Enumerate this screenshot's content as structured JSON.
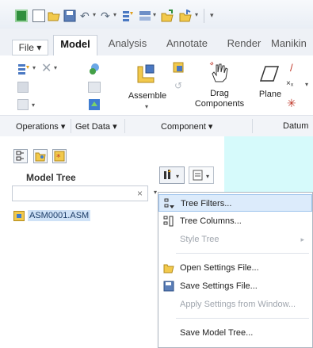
{
  "quick_access": {
    "icons": [
      "new-icon",
      "open-icon",
      "save-icon",
      "undo-icon",
      "redo-icon",
      "regenerate-icon",
      "windows-icon",
      "open-folder-icon",
      "customize-icon"
    ]
  },
  "tabs": {
    "file": "File",
    "items": [
      {
        "label": "Model",
        "active": true
      },
      {
        "label": "Analysis"
      },
      {
        "label": "Annotate"
      },
      {
        "label": "Render"
      },
      {
        "label": "Manikin"
      }
    ]
  },
  "ribbon": {
    "assemble": "Assemble",
    "drag_components": "Drag Components",
    "plane": "Plane",
    "groups": {
      "operations": "Operations",
      "get_data": "Get Data",
      "component": "Component",
      "datum": "Datum"
    }
  },
  "model_tree": {
    "title": "Model Tree",
    "search_placeholder": "",
    "clear": "×",
    "root_item": "ASM0001.ASM"
  },
  "menu": {
    "items": [
      {
        "label": "Tree Filters...",
        "enabled": true,
        "highlighted": true,
        "icon": "tree-filters-icon"
      },
      {
        "label": "Tree Columns...",
        "enabled": true,
        "icon": "tree-columns-icon"
      },
      {
        "label": "Style Tree",
        "enabled": false,
        "submenu": true
      },
      {
        "label": "Open Settings File...",
        "enabled": true,
        "icon": "open-folder-icon"
      },
      {
        "label": "Save Settings File...",
        "enabled": true,
        "icon": "save-icon"
      },
      {
        "label": "Apply Settings from Window...",
        "enabled": false
      },
      {
        "label": "Save Model Tree...",
        "enabled": true
      }
    ]
  },
  "colors": {
    "graphics_area": "#d6fafb",
    "highlight": "#dcebfb",
    "selection": "#cfe2f7"
  }
}
